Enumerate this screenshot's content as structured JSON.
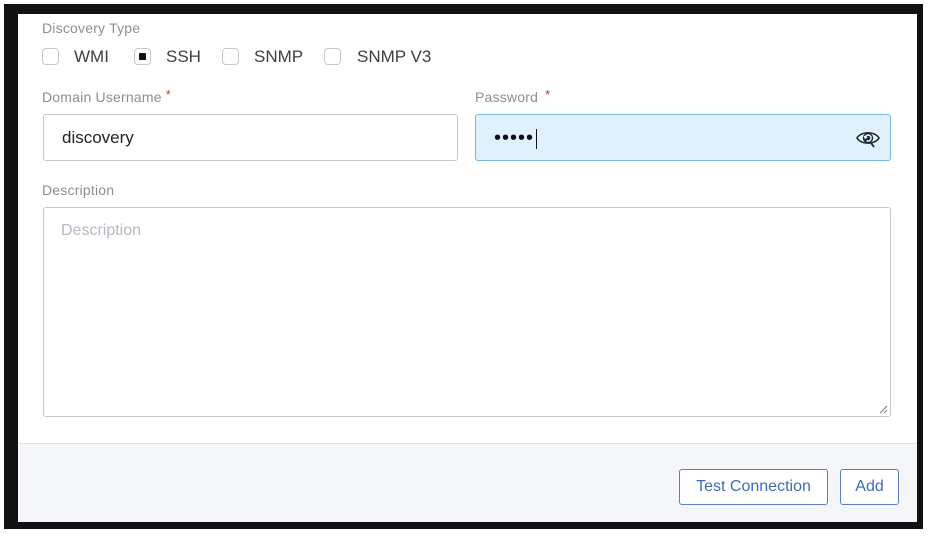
{
  "discovery_type": {
    "label": "Discovery Type",
    "options": [
      {
        "label": "WMI",
        "checked": false
      },
      {
        "label": "SSH",
        "checked": true
      },
      {
        "label": "SNMP",
        "checked": false
      },
      {
        "label": "SNMP V3",
        "checked": false
      }
    ]
  },
  "domain_username": {
    "label": "Domain Username",
    "required_mark": "*",
    "value": "discovery"
  },
  "password": {
    "label": "Password",
    "required_mark": "*",
    "masked_value": "•••••",
    "icon": "eye-refresh-icon"
  },
  "description": {
    "label": "Description",
    "placeholder": "Description",
    "value": ""
  },
  "footer": {
    "test_connection_label": "Test Connection",
    "add_label": "Add"
  },
  "colors": {
    "accent": "#3e6db5",
    "required": "#d93025",
    "password_bg": "#dff1fd"
  }
}
